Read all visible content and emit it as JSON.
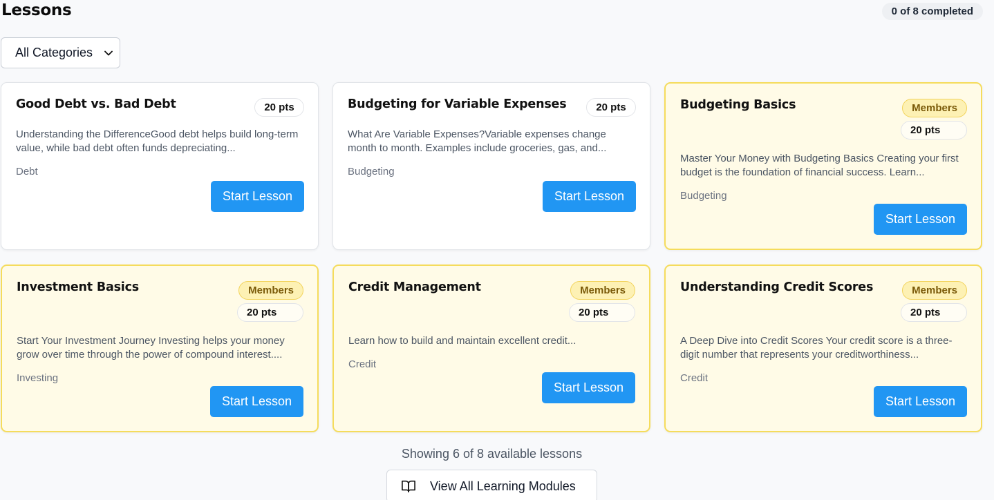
{
  "header": {
    "title": "Lessons",
    "progress": "0 of 8 completed"
  },
  "filter": {
    "selected": "All Categories"
  },
  "lessons": [
    {
      "title": "Good Debt vs. Bad Debt",
      "members": false,
      "points": "20 pts",
      "description": "Understanding the DifferenceGood debt helps build long-term value, while bad debt often funds depreciating...",
      "category": "Debt",
      "button": "Start Lesson"
    },
    {
      "title": "Budgeting for Variable Expenses",
      "members": false,
      "points": "20 pts",
      "description": "What Are Variable Expenses?Variable expenses change month to month. Examples include groceries, gas, and...",
      "category": "Budgeting",
      "button": "Start Lesson"
    },
    {
      "title": "Budgeting Basics",
      "members": true,
      "members_label": "Members",
      "points": "20 pts",
      "description": "Master Your Money with Budgeting Basics Creating your first budget is the foundation of financial success. Learn...",
      "category": "Budgeting",
      "button": "Start Lesson"
    },
    {
      "title": "Investment Basics",
      "members": true,
      "members_label": "Members",
      "points": "20 pts",
      "description": "Start Your Investment Journey Investing helps your money grow over time through the power of compound interest....",
      "category": "Investing",
      "button": "Start Lesson"
    },
    {
      "title": "Credit Management",
      "members": true,
      "members_label": "Members",
      "points": "20 pts",
      "description": "Learn how to build and maintain excellent credit...",
      "category": "Credit",
      "button": "Start Lesson"
    },
    {
      "title": "Understanding Credit Scores",
      "members": true,
      "members_label": "Members",
      "points": "20 pts",
      "description": "A Deep Dive into Credit Scores Your credit score is a three-digit number that represents your creditworthiness...",
      "category": "Credit",
      "button": "Start Lesson"
    }
  ],
  "footer": {
    "showing": "Showing 6 of 8 available lessons",
    "view_all": "View All Learning Modules",
    "view_all_icon": "book-open-icon"
  },
  "colors": {
    "accent": "#2196f3",
    "member_bg": "#fffbe7",
    "member_border": "#f5dc5c",
    "member_badge": "#fdf1b4"
  }
}
